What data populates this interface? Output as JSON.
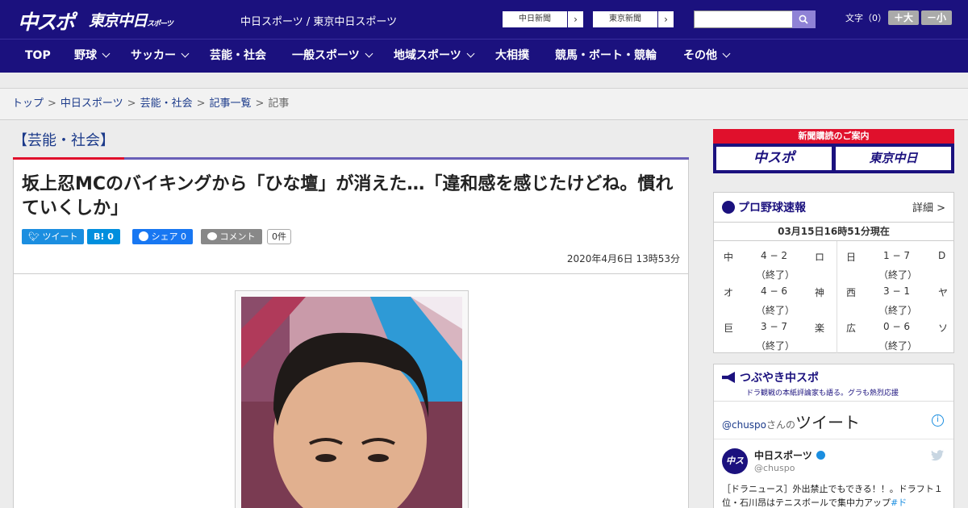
{
  "header": {
    "logo_main": "中スポ",
    "logo_tokyo": "東京中日",
    "logo_tokyo_sub": "スポーツ",
    "site_name": "中日スポーツ / 東京中日スポーツ",
    "links": [
      {
        "label": "中日新聞"
      },
      {
        "label": "東京新聞"
      }
    ],
    "search_placeholder": "",
    "font_label": "文字（0）",
    "font_plus": "＋大",
    "font_minus": "－小"
  },
  "nav": {
    "items": [
      {
        "label": "TOP"
      },
      {
        "label": "野球"
      },
      {
        "label": "サッカー"
      },
      {
        "label": "芸能・社会"
      },
      {
        "label": "一般スポーツ"
      },
      {
        "label": "地域スポーツ"
      },
      {
        "label": "大相撲"
      },
      {
        "label": "競馬・ボート・競輪"
      },
      {
        "label": "その他"
      }
    ]
  },
  "breadcrumb": {
    "items": [
      "トップ",
      "中日スポーツ",
      "芸能・社会",
      "記事一覧"
    ],
    "current": "記事",
    "separator": ">"
  },
  "article": {
    "category": "【芸能・社会】",
    "headline": "坂上忍MCのバイキングから「ひな壇」が消えた…「違和感を感じたけどね。慣れていくしか」",
    "share": {
      "tweet": "ツイート",
      "hatena": "B! 0",
      "facebook": "シェア 0",
      "comment": "コメント",
      "comment_count": "0件"
    },
    "date": "2020年4月6日 13時53分"
  },
  "sidebar": {
    "subscribe": {
      "head": "新聞購読のご案内",
      "box1": "中スポ",
      "box2": "東京中日"
    },
    "baseball": {
      "title": "プロ野球速報",
      "detail": "詳細 >",
      "time": "03月15日16時51分現在",
      "games": [
        {
          "home": "中",
          "score": "4 − 2",
          "away": "ロ",
          "status": "（終了）"
        },
        {
          "home": "日",
          "score": "1 − 7",
          "away": "D",
          "status": "（終了）"
        },
        {
          "home": "オ",
          "score": "4 − 6",
          "away": "神",
          "status": "（終了）"
        },
        {
          "home": "西",
          "score": "3 − 1",
          "away": "ヤ",
          "status": "（終了）"
        },
        {
          "home": "巨",
          "score": "3 − 7",
          "away": "楽",
          "status": "（終了）"
        },
        {
          "home": "広",
          "score": "0 − 6",
          "away": "ソ",
          "status": "（終了）"
        }
      ]
    },
    "twitter": {
      "title": "つぶやき中スポ",
      "subtitle": "ドラ観戦の本紙評論家も語る。グラも熱烈応援",
      "handle_link": "@chuspo",
      "handle_suffix": "さんの",
      "heading_big": "ツイート",
      "account_name": "中日スポーツ",
      "account_handle": "@chuspo",
      "avatar": "中スポ",
      "tweet_text": "［ドラニュース］外出禁止でもできる！！。ドラフト１位・石川昂はテニスボールで集中力アップ",
      "tweet_link": "#ド"
    }
  },
  "colors": {
    "brand": "#1b117e",
    "accent_red": "#e0102c",
    "twitter_blue": "#1b8ee0",
    "hatena_blue": "#008fde",
    "facebook_blue": "#1877f2",
    "comment_gray": "#888888"
  }
}
